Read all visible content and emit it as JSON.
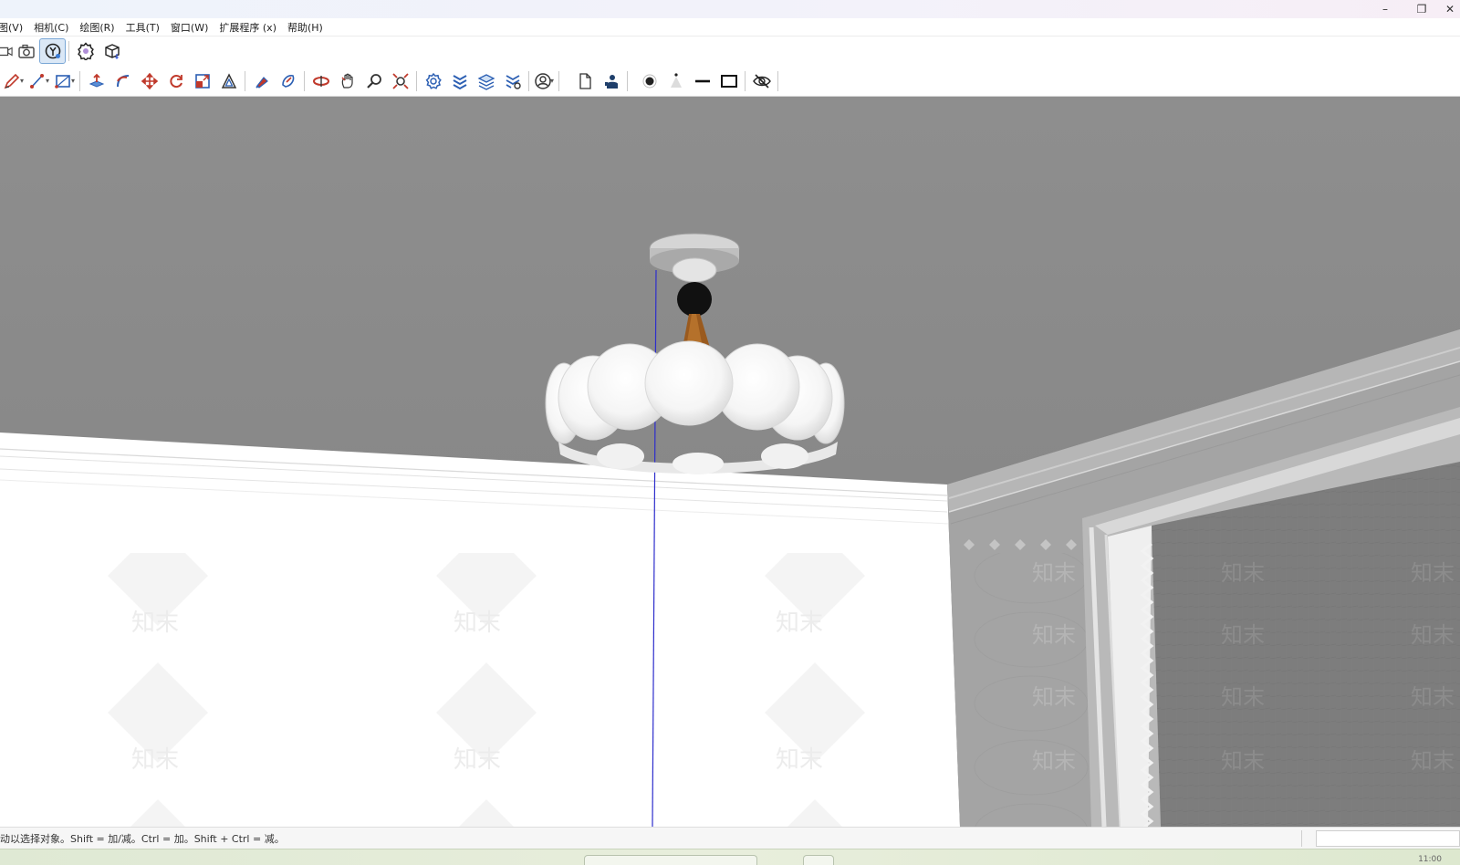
{
  "menubar": {
    "items": [
      "图(V)",
      "相机(C)",
      "绘图(R)",
      "工具(T)",
      "窗口(W)",
      "扩展程序 (x)",
      "帮助(H)"
    ]
  },
  "toolbar_top": {
    "icons": [
      "previous-view-icon",
      "camera-icon",
      "walk-orbit-icon",
      "component-gear-icon",
      "cube-export-icon"
    ],
    "selected": "walk-orbit-icon"
  },
  "toolbar_main": {
    "icons": [
      "pencil-icon",
      "line-icon",
      "rectangle-icon",
      "push-pull-icon",
      "follow-me-icon",
      "move-icon",
      "rotate-icon",
      "scale-icon",
      "offset-icon",
      "paint-icon",
      "section-icon",
      "orbit-icon",
      "pan-icon",
      "zoom-icon",
      "zoom-extents-icon",
      "materials-icon",
      "layers-icon",
      "layers-stack-icon",
      "layers-settings-icon",
      "user-circle-icon",
      "new-page-icon",
      "person-icon",
      "shadow-point-icon",
      "light-cone-icon",
      "line-weight-icon",
      "rectangle-outline-icon",
      "hide-eye-icon"
    ]
  },
  "viewport": {
    "watermark_text": "知末",
    "colors": {
      "ceiling": "#8c8c8c",
      "wall_left": "#ffffff",
      "wall_right": "#a6a6a6",
      "axis_blue": "#2d2dcc",
      "lamp_brass": "#9a5a1e"
    }
  },
  "statusbar": {
    "text": "动以选择对象。Shift = 加/减。Ctrl = 加。Shift + Ctrl = 减。"
  },
  "taskbar": {
    "time": "11:00"
  }
}
